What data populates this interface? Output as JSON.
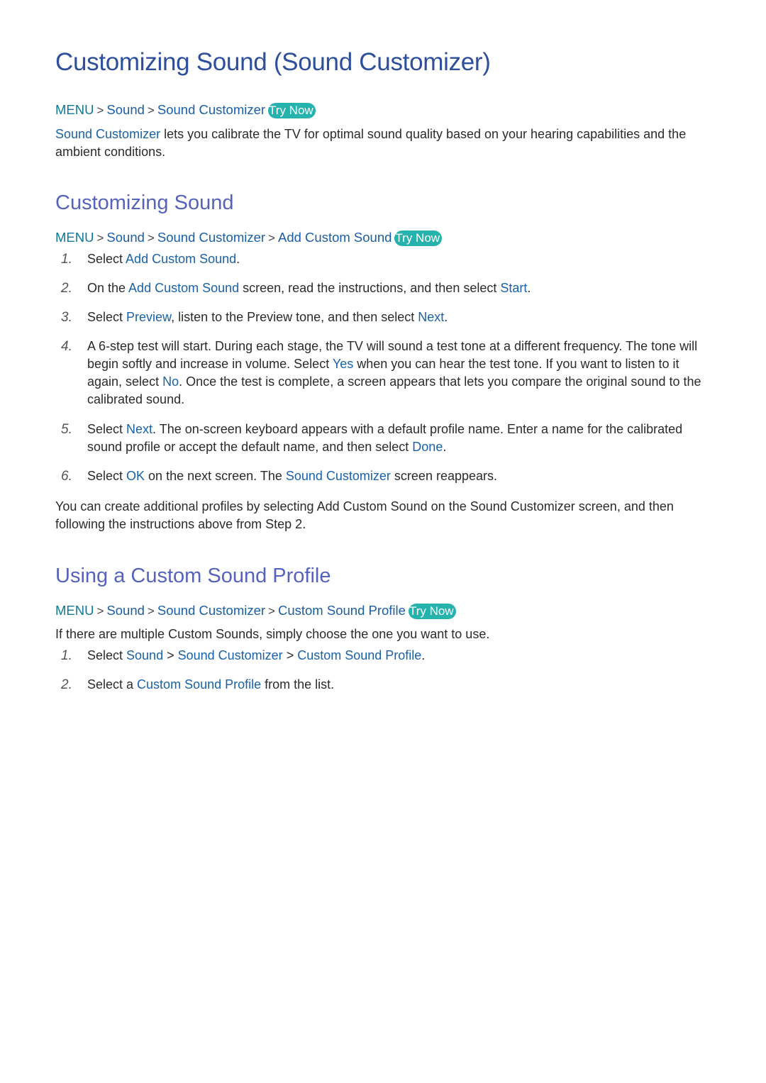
{
  "title": "Customizing Sound (Sound Customizer)",
  "intro": {
    "path": [
      "MENU",
      "Sound",
      "Sound Customizer"
    ],
    "badge": "Try Now",
    "desc_link": "Sound Customizer",
    "desc_rest": " lets you calibrate the TV for optimal sound quality based on your hearing capabilities and the ambient conditions."
  },
  "section1": {
    "heading": "Customizing Sound",
    "path": [
      "MENU",
      "Sound",
      "Sound Customizer",
      "Add Custom Sound"
    ],
    "badge": "Try Now",
    "steps": [
      {
        "num": "1.",
        "parts": [
          {
            "t": "Select "
          },
          {
            "t": "Add Custom Sound",
            "l": true
          },
          {
            "t": "."
          }
        ]
      },
      {
        "num": "2.",
        "parts": [
          {
            "t": "On the "
          },
          {
            "t": "Add Custom Sound",
            "l": true
          },
          {
            "t": " screen, read the instructions, and then select "
          },
          {
            "t": "Start",
            "l": true
          },
          {
            "t": "."
          }
        ]
      },
      {
        "num": "3.",
        "parts": [
          {
            "t": "Select "
          },
          {
            "t": "Preview",
            "l": true
          },
          {
            "t": ", listen to the Preview tone, and then select "
          },
          {
            "t": "Next",
            "l": true
          },
          {
            "t": "."
          }
        ]
      },
      {
        "num": "4.",
        "parts": [
          {
            "t": "A 6-step test will start. During each stage, the TV will sound a test tone at a different frequency. The tone will begin softly and increase in volume. Select "
          },
          {
            "t": "Yes",
            "l": true
          },
          {
            "t": " when you can hear the test tone. If you want to listen to it again, select "
          },
          {
            "t": "No",
            "l": true
          },
          {
            "t": ". Once the test is complete, a screen appears that lets you compare the original sound to the calibrated sound."
          }
        ]
      },
      {
        "num": "5.",
        "parts": [
          {
            "t": "Select "
          },
          {
            "t": "Next",
            "l": true
          },
          {
            "t": ". The on-screen keyboard appears with a default profile name. Enter a name for the calibrated sound profile or accept the default name, and then select "
          },
          {
            "t": "Done",
            "l": true
          },
          {
            "t": "."
          }
        ]
      },
      {
        "num": "6.",
        "parts": [
          {
            "t": "Select "
          },
          {
            "t": "OK",
            "l": true
          },
          {
            "t": " on the next screen. The "
          },
          {
            "t": "Sound Customizer",
            "l": true
          },
          {
            "t": " screen reappears."
          }
        ]
      }
    ],
    "note": "You can create additional profiles by selecting Add Custom Sound on the Sound Customizer screen, and then following the instructions above from Step 2."
  },
  "section2": {
    "heading": "Using a Custom Sound Profile",
    "path": [
      "MENU",
      "Sound",
      "Sound Customizer",
      "Custom Sound Profile"
    ],
    "badge": "Try Now",
    "desc": "If there are multiple Custom Sounds, simply choose the one you want to use.",
    "steps": [
      {
        "num": "1.",
        "parts": [
          {
            "t": "Select "
          },
          {
            "t": "Sound",
            "l": true
          },
          {
            "t": " > ",
            "sep": true
          },
          {
            "t": "Sound Customizer",
            "l": true
          },
          {
            "t": " > ",
            "sep": true
          },
          {
            "t": "Custom Sound Profile",
            "l": true
          },
          {
            "t": "."
          }
        ]
      },
      {
        "num": "2.",
        "parts": [
          {
            "t": "Select a "
          },
          {
            "t": "Custom Sound Profile",
            "l": true
          },
          {
            "t": " from the list."
          }
        ]
      }
    ]
  }
}
